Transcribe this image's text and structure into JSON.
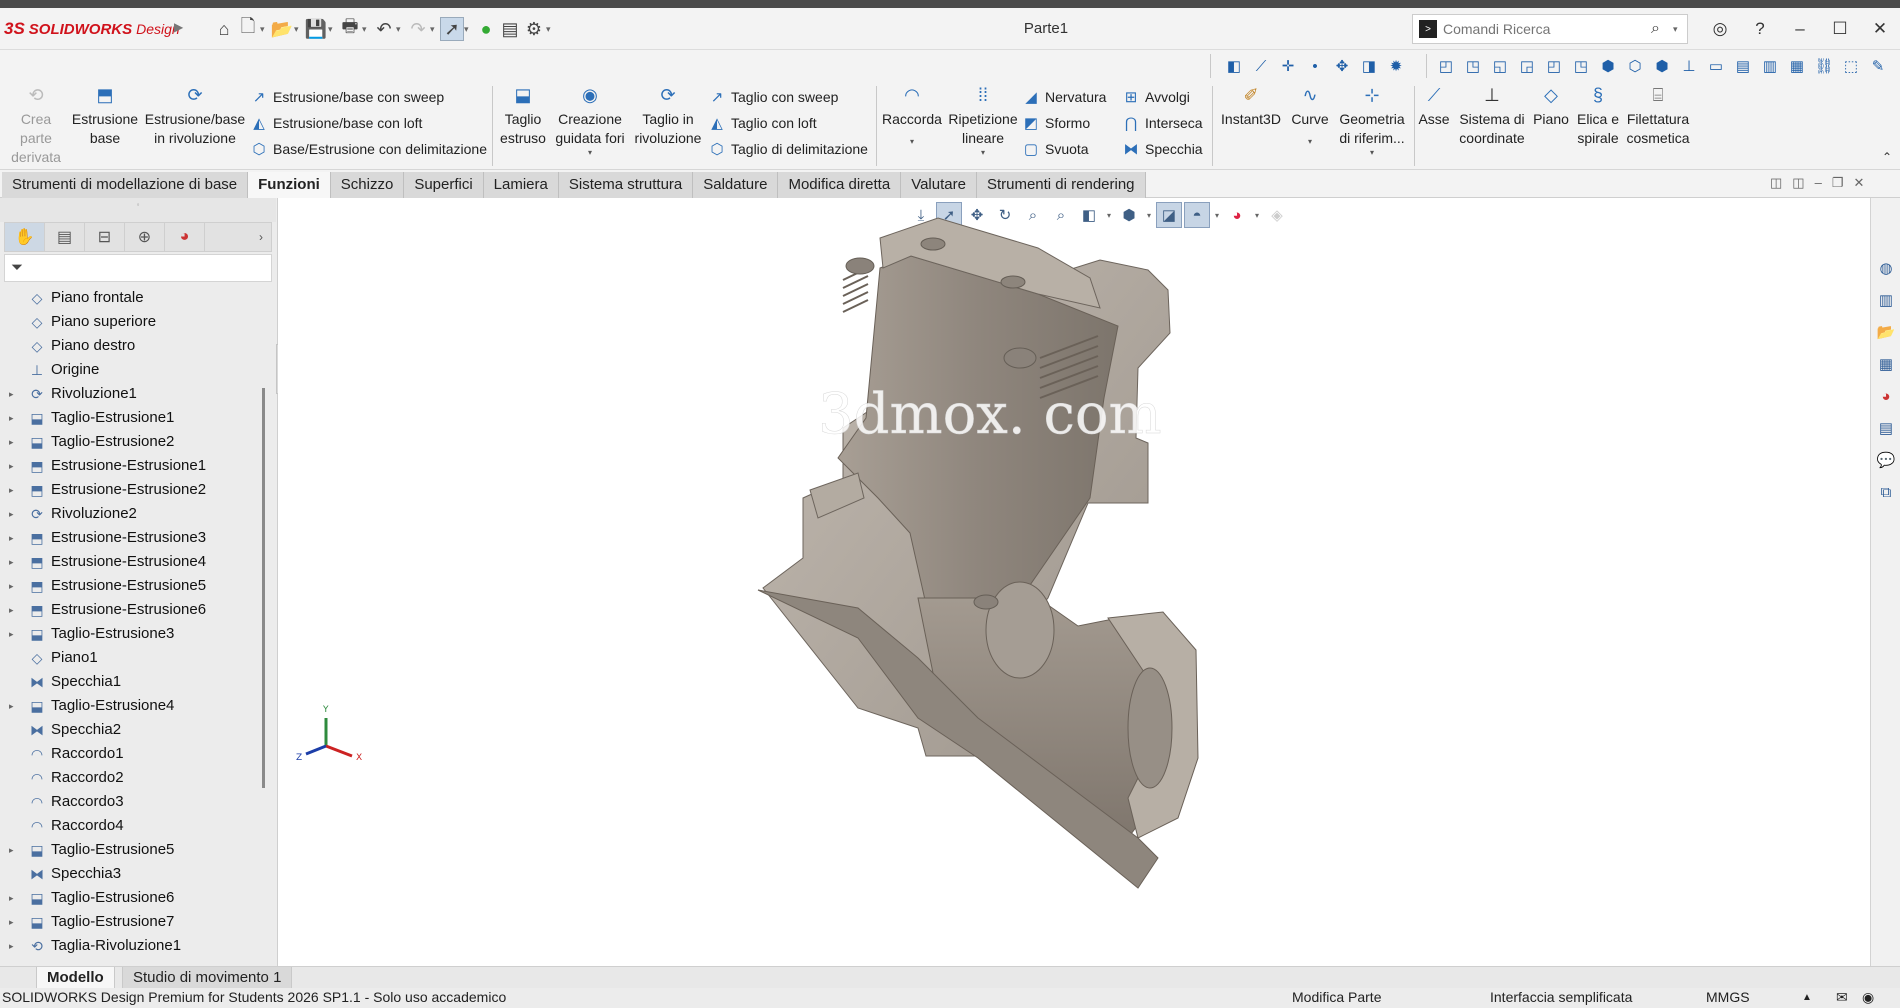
{
  "titlebar": {
    "logo_ds": "3S",
    "logo_brand": "SOLIDWORKS",
    "logo_product": "Design",
    "document_title": "Parte1",
    "search_placeholder": "Comandi Ricerca"
  },
  "ribbon": {
    "crea_parte_derivata": "Crea parte derivata",
    "estrusione_base": "Estrusione base",
    "estrusione_rivoluzione": "Estrusione/base in rivoluzione",
    "estrusione_sweep": "Estrusione/base con sweep",
    "estrusione_loft": "Estrusione/base con loft",
    "base_delimitazione": "Base/Estrusione con delimitazione",
    "taglio_estruso": "Taglio estruso",
    "creazione_guidata_fori": "Creazione guidata fori",
    "taglio_rivoluzione": "Taglio in rivoluzione",
    "taglio_sweep": "Taglio con sweep",
    "taglio_loft": "Taglio con loft",
    "taglio_delimitazione": "Taglio di delimitazione",
    "raccorda": "Raccorda",
    "ripetizione_lineare": "Ripetizione lineare",
    "nervatura": "Nervatura",
    "sformo": "Sformo",
    "svuota": "Svuota",
    "avvolgi": "Avvolgi",
    "interseca": "Interseca",
    "specchia": "Specchia",
    "instant3d": "Instant3D",
    "curve": "Curve",
    "geometria_riferimento": "Geometria di riferim...",
    "asse": "Asse",
    "sistema_coordinate": "Sistema di coordinate",
    "piano": "Piano",
    "elica_spirale": "Elica e spirale",
    "filettatura_cosmetica": "Filettatura cosmetica"
  },
  "tabs": [
    {
      "label": "Strumenti di modellazione di base",
      "active": false
    },
    {
      "label": "Funzioni",
      "active": true
    },
    {
      "label": "Schizzo",
      "active": false
    },
    {
      "label": "Superfici",
      "active": false
    },
    {
      "label": "Lamiera",
      "active": false
    },
    {
      "label": "Sistema struttura",
      "active": false
    },
    {
      "label": "Saldature",
      "active": false
    },
    {
      "label": "Modifica diretta",
      "active": false
    },
    {
      "label": "Valutare",
      "active": false
    },
    {
      "label": "Strumenti di rendering",
      "active": false
    }
  ],
  "tree": [
    {
      "label": "Piano frontale",
      "icon": "plane-icon",
      "expandable": false
    },
    {
      "label": "Piano superiore",
      "icon": "plane-icon",
      "expandable": false
    },
    {
      "label": "Piano destro",
      "icon": "plane-icon",
      "expandable": false
    },
    {
      "label": "Origine",
      "icon": "origin-icon",
      "expandable": false
    },
    {
      "label": "Rivoluzione1",
      "icon": "revolve-icon",
      "expandable": true
    },
    {
      "label": "Taglio-Estrusione1",
      "icon": "cut-extrude-icon",
      "expandable": true
    },
    {
      "label": "Taglio-Estrusione2",
      "icon": "cut-extrude-icon",
      "expandable": true
    },
    {
      "label": "Estrusione-Estrusione1",
      "icon": "extrude-icon",
      "expandable": true
    },
    {
      "label": "Estrusione-Estrusione2",
      "icon": "extrude-icon",
      "expandable": true
    },
    {
      "label": "Rivoluzione2",
      "icon": "revolve-icon",
      "expandable": true
    },
    {
      "label": "Estrusione-Estrusione3",
      "icon": "extrude-icon",
      "expandable": true
    },
    {
      "label": "Estrusione-Estrusione4",
      "icon": "extrude-icon",
      "expandable": true
    },
    {
      "label": "Estrusione-Estrusione5",
      "icon": "extrude-icon",
      "expandable": true
    },
    {
      "label": "Estrusione-Estrusione6",
      "icon": "extrude-icon",
      "expandable": true
    },
    {
      "label": "Taglio-Estrusione3",
      "icon": "cut-extrude-icon",
      "expandable": true
    },
    {
      "label": "Piano1",
      "icon": "plane-icon",
      "expandable": false
    },
    {
      "label": "Specchia1",
      "icon": "mirror-icon",
      "expandable": false
    },
    {
      "label": "Taglio-Estrusione4",
      "icon": "cut-extrude-icon",
      "expandable": true
    },
    {
      "label": "Specchia2",
      "icon": "mirror-icon",
      "expandable": false
    },
    {
      "label": "Raccordo1",
      "icon": "fillet-icon",
      "expandable": false
    },
    {
      "label": "Raccordo2",
      "icon": "fillet-icon",
      "expandable": false
    },
    {
      "label": "Raccordo3",
      "icon": "fillet-icon",
      "expandable": false
    },
    {
      "label": "Raccordo4",
      "icon": "fillet-icon",
      "expandable": false
    },
    {
      "label": "Taglio-Estrusione5",
      "icon": "cut-extrude-icon",
      "expandable": true
    },
    {
      "label": "Specchia3",
      "icon": "mirror-icon",
      "expandable": false
    },
    {
      "label": "Taglio-Estrusione6",
      "icon": "cut-extrude-icon",
      "expandable": true
    },
    {
      "label": "Taglio-Estrusione7",
      "icon": "cut-extrude-icon",
      "expandable": true
    },
    {
      "label": "Taglia-Rivoluzione1",
      "icon": "cut-revolve-icon",
      "expandable": true
    }
  ],
  "viewport": {
    "watermark": "3dmox. com",
    "axis_x": "X",
    "axis_y": "Y",
    "axis_z": "Z"
  },
  "bottom_tabs": {
    "model": "Modello",
    "motion_study": "Studio di movimento 1"
  },
  "status": {
    "product": "SOLIDWORKS Design Premium for Students 2026 SP1.1 - Solo uso accademico",
    "mode": "Modifica Parte",
    "interface": "Interfaccia semplificata",
    "units": "MMGS",
    "units_arrow": "▲"
  },
  "colors": {
    "brand_red": "#d0121b",
    "icon_blue": "#2c6fb8",
    "model_surface": "#b2aaa1",
    "model_inner": "#8e857c",
    "ribbon_bg": "#f3f3f3"
  }
}
